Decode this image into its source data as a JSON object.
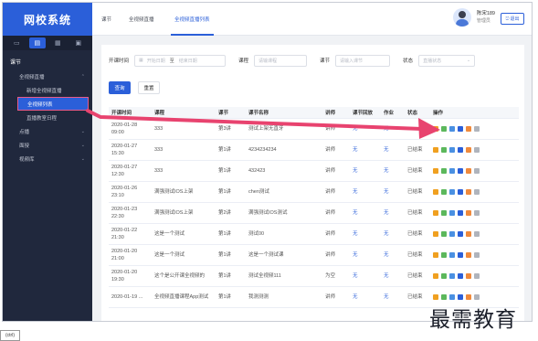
{
  "brand": "网校系统",
  "side_icons": [
    "monitor-icon",
    "doc-icon",
    "book-icon",
    "video-icon"
  ],
  "sidebar": {
    "section": "课节",
    "items": [
      {
        "label": "全视频直播",
        "chev": "^"
      },
      {
        "label": "新增全视频直播",
        "chev": ""
      },
      {
        "label": "全视频列表",
        "chev": ""
      },
      {
        "label": "直播教室日程",
        "chev": ""
      },
      {
        "label": "点播",
        "chev": "v"
      },
      {
        "label": "面授",
        "chev": "v"
      },
      {
        "label": "视频库",
        "chev": "v"
      }
    ]
  },
  "topbar": {
    "tabs": [
      "课节",
      "全视频直播",
      "全视频直播列表"
    ],
    "user_name": "陈宋189",
    "user_role": "管理员",
    "logout": "退出"
  },
  "filters": {
    "start_label": "开课时间",
    "start_ph": "开始日期",
    "sep": "至",
    "end_ph": "结束日期",
    "course_label": "课程",
    "course_ph": "请输课程",
    "lesson_label": "课节",
    "lesson_ph": "请输入课节",
    "status_label": "状态",
    "status_ph": "直播状态"
  },
  "buttons": {
    "search": "查询",
    "reset": "重置"
  },
  "table": {
    "headers": [
      "开课时间",
      "课程",
      "课节",
      "课节名称",
      "讲师",
      "课节回放",
      "作业",
      "状态",
      "操作"
    ],
    "rows": [
      [
        "2020-01-28 09:00",
        "333",
        "第3讲",
        "测试上架无直牙",
        "讲师",
        "无",
        "无",
        "",
        ""
      ],
      [
        "2020-01-27 15:30",
        "333",
        "第1讲",
        "4234234234",
        "讲师",
        "无",
        "无",
        "已结束",
        ""
      ],
      [
        "2020-01-27 12:30",
        "333",
        "第1讲",
        "432423",
        "讲师",
        "无",
        "无",
        "已结束",
        ""
      ],
      [
        "2020-01-26 23:10",
        "满强测试IOS上架",
        "第1讲",
        "chen测试",
        "讲师",
        "无",
        "无",
        "已结束",
        ""
      ],
      [
        "2020-01-23 22:30",
        "满强测试IOS上架",
        "第2讲",
        "满强测试IOS测试",
        "讲师",
        "无",
        "无",
        "已结束",
        ""
      ],
      [
        "2020-01-22 21:30",
        "这是一个测试",
        "第1讲",
        "测试00",
        "讲师",
        "无",
        "无",
        "已结束",
        ""
      ],
      [
        "2020-01-20 21:00",
        "这是一个测试",
        "第1讲",
        "这是一个测试课",
        "讲师",
        "无",
        "无",
        "已结束",
        ""
      ],
      [
        "2020-01-20 19:30",
        "这个是公开课全视频的",
        "第1讲",
        "测试全视频111",
        "为空",
        "无",
        "无",
        "已结束",
        ""
      ],
      [
        "2020-01-19 ...",
        "全视频直播课程App测试",
        "第1讲",
        "我测测测",
        "讲师",
        "无",
        "无",
        "已结束",
        ""
      ]
    ]
  },
  "ops_colors": [
    "#f0a020",
    "#5cb85c",
    "#4a90e2",
    "#2b5fd9",
    "#f08a3c",
    "#b0b4bc"
  ],
  "arrow_color": "#e8436f",
  "watermark": "最需教育",
  "corner_label": "(ctrl)"
}
